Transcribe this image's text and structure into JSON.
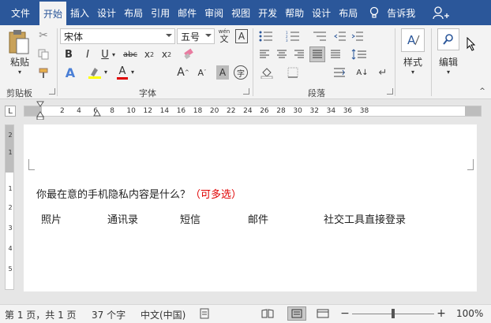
{
  "tabs": [
    {
      "label": "文件"
    },
    {
      "label": "开始"
    },
    {
      "label": "插入"
    },
    {
      "label": "设计"
    },
    {
      "label": "布局"
    },
    {
      "label": "引用"
    },
    {
      "label": "邮件"
    },
    {
      "label": "审阅"
    },
    {
      "label": "视图"
    },
    {
      "label": "开发"
    },
    {
      "label": "帮助"
    },
    {
      "label": "设计"
    },
    {
      "label": "布局"
    }
  ],
  "tell_me": "告诉我",
  "ribbon": {
    "clipboard": {
      "paste_label": "粘贴",
      "group_label": "剪贴板"
    },
    "font": {
      "font_name": "宋体",
      "font_size": "五号",
      "group_label": "字体",
      "wen_label": "wén",
      "wen_char": "文"
    },
    "paragraph": {
      "group_label": "段落"
    },
    "styles": {
      "label": "样式"
    },
    "editing": {
      "label": "编辑"
    }
  },
  "ruler": {
    "ticks": [
      "2",
      "4",
      "6",
      "8",
      "10",
      "12",
      "14",
      "16",
      "18",
      "20",
      "22",
      "24",
      "26",
      "28",
      "30",
      "32",
      "34",
      "36",
      "38"
    ],
    "vticks": [
      "2",
      "1",
      "1",
      "2",
      "3",
      "4",
      "5"
    ]
  },
  "document": {
    "question": "你最在意的手机隐私内容是什么？",
    "question_hint": "（可多选）",
    "options": [
      "照片",
      "通讯录",
      "短信",
      "邮件",
      "社交工具直接登录"
    ]
  },
  "status": {
    "page": "第 1 页，共 1 页",
    "words": "37 个字",
    "language": "中文(中国)",
    "zoom": "100%"
  }
}
